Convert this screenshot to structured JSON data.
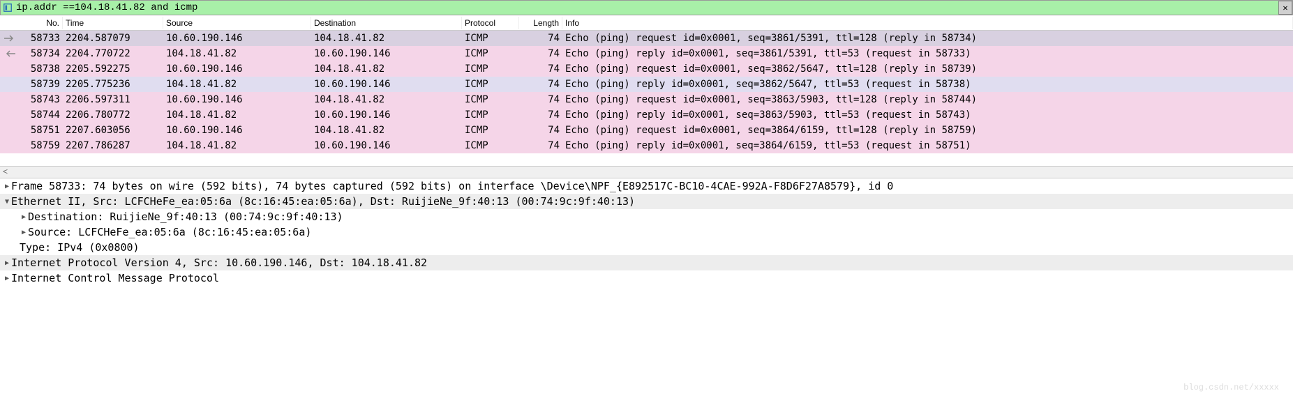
{
  "filter": {
    "value": "ip.addr ==104.18.41.82 and icmp"
  },
  "columns": {
    "no": "No.",
    "time": "Time",
    "src": "Source",
    "dst": "Destination",
    "proto": "Protocol",
    "len": "Length",
    "info": "Info"
  },
  "packets": [
    {
      "no": "58733",
      "time": "2204.587079",
      "src": "10.60.190.146",
      "dst": "104.18.41.82",
      "proto": "ICMP",
      "len": "74",
      "info": "Echo (ping) request  id=0x0001, seq=3861/5391, ttl=128 (reply in 58734)",
      "bg": "sel",
      "arrow": "out"
    },
    {
      "no": "58734",
      "time": "2204.770722",
      "src": "104.18.41.82",
      "dst": "10.60.190.146",
      "proto": "ICMP",
      "len": "74",
      "info": "Echo (ping) reply    id=0x0001, seq=3861/5391, ttl=53 (request in 58733)",
      "bg": "req",
      "arrow": "in"
    },
    {
      "no": "58738",
      "time": "2205.592275",
      "src": "10.60.190.146",
      "dst": "104.18.41.82",
      "proto": "ICMP",
      "len": "74",
      "info": "Echo (ping) request  id=0x0001, seq=3862/5647, ttl=128 (reply in 58739)",
      "bg": "req",
      "arrow": ""
    },
    {
      "no": "58739",
      "time": "2205.775236",
      "src": "104.18.41.82",
      "dst": "10.60.190.146",
      "proto": "ICMP",
      "len": "74",
      "info": "Echo (ping) reply    id=0x0001, seq=3862/5647, ttl=53 (request in 58738)",
      "bg": "hl",
      "arrow": ""
    },
    {
      "no": "58743",
      "time": "2206.597311",
      "src": "10.60.190.146",
      "dst": "104.18.41.82",
      "proto": "ICMP",
      "len": "74",
      "info": "Echo (ping) request  id=0x0001, seq=3863/5903, ttl=128 (reply in 58744)",
      "bg": "req",
      "arrow": ""
    },
    {
      "no": "58744",
      "time": "2206.780772",
      "src": "104.18.41.82",
      "dst": "10.60.190.146",
      "proto": "ICMP",
      "len": "74",
      "info": "Echo (ping) reply    id=0x0001, seq=3863/5903, ttl=53 (request in 58743)",
      "bg": "req",
      "arrow": ""
    },
    {
      "no": "58751",
      "time": "2207.603056",
      "src": "10.60.190.146",
      "dst": "104.18.41.82",
      "proto": "ICMP",
      "len": "74",
      "info": "Echo (ping) request  id=0x0001, seq=3864/6159, ttl=128 (reply in 58759)",
      "bg": "req",
      "arrow": ""
    },
    {
      "no": "58759",
      "time": "2207.786287",
      "src": "104.18.41.82",
      "dst": "10.60.190.146",
      "proto": "ICMP",
      "len": "74",
      "info": "Echo (ping) reply    id=0x0001, seq=3864/6159, ttl=53 (request in 58751)",
      "bg": "req",
      "arrow": ""
    }
  ],
  "details": {
    "frame": "Frame 58733: 74 bytes on wire (592 bits), 74 bytes captured (592 bits) on interface \\Device\\NPF_{E892517C-BC10-4CAE-992A-F8D6F27A8579}, id 0",
    "eth": "Ethernet II, Src: LCFCHeFe_ea:05:6a (8c:16:45:ea:05:6a), Dst: RuijieNe_9f:40:13 (00:74:9c:9f:40:13)",
    "eth_dst": "Destination: RuijieNe_9f:40:13 (00:74:9c:9f:40:13)",
    "eth_src": "Source: LCFCHeFe_ea:05:6a (8c:16:45:ea:05:6a)",
    "eth_type": "Type: IPv4 (0x0800)",
    "ip": "Internet Protocol Version 4, Src: 10.60.190.146, Dst: 104.18.41.82",
    "icmp": "Internet Control Message Protocol"
  },
  "scroll_left_arrow": "<",
  "close_label": "✕",
  "watermark": "blog.csdn.net/xxxxx"
}
